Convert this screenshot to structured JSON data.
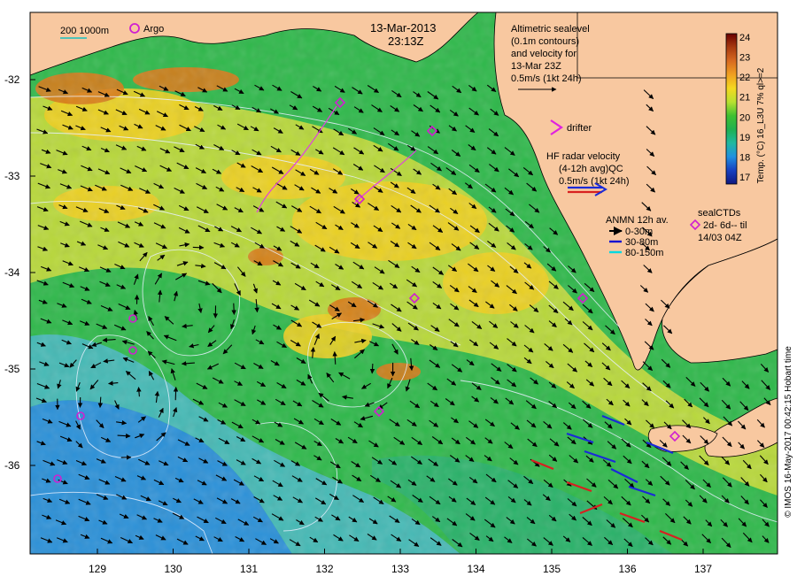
{
  "header": {
    "date": "13-Mar-2013",
    "time": "23:13Z",
    "scale_bar": "200  1000m",
    "argo_label": "Argo"
  },
  "altimetry": {
    "lines": [
      "Altimetric sealevel",
      "(0.1m contours)",
      "and velocity for",
      "13-Mar 23Z",
      "0.5m/s (1kt 24h)"
    ]
  },
  "drifter": {
    "label": "drifter"
  },
  "hf_radar": {
    "lines": [
      "HF radar velocity",
      "(4-12h avg)QC",
      "0.5m/s (1kt 24h)"
    ]
  },
  "anmn": {
    "title": "ANMN 12h av.",
    "items": [
      {
        "label": "0-30m",
        "color": "#000000"
      },
      {
        "label": "30-80m",
        "color": "#1010d0"
      },
      {
        "label": "80-150m",
        "color": "#00d8e0"
      }
    ]
  },
  "sealctds": {
    "lines": [
      "sealCTDs",
      "2d- 6d-- til",
      "14/03 04Z"
    ]
  },
  "colorbar": {
    "ticks": [
      "24",
      "23",
      "22",
      "21",
      "20",
      "19",
      "18",
      "17"
    ],
    "label": "Temp. (°C) 16_L3U 7% ql>=2",
    "stops": [
      "#6a0000",
      "#a83a10",
      "#d86a20",
      "#f0a020",
      "#f4d820",
      "#b8e030",
      "#40c030",
      "#20b050",
      "#20b8a0",
      "#2090e0",
      "#1840c0",
      "#101880"
    ]
  },
  "y_axis": {
    "ticks": [
      "-32",
      "-33",
      "-34",
      "-35",
      "-36"
    ]
  },
  "x_axis": {
    "ticks": [
      "129",
      "130",
      "131",
      "132",
      "133",
      "134",
      "135",
      "136",
      "137"
    ]
  },
  "credit": "© IMOS 16-May-2017 00:42:15 Hobart time",
  "colors": {
    "land": "#f8c8a0",
    "cold": "#2a7fd8",
    "mid": "#2eb84a",
    "warm": "#e8d020",
    "hot": "#d87a18"
  }
}
